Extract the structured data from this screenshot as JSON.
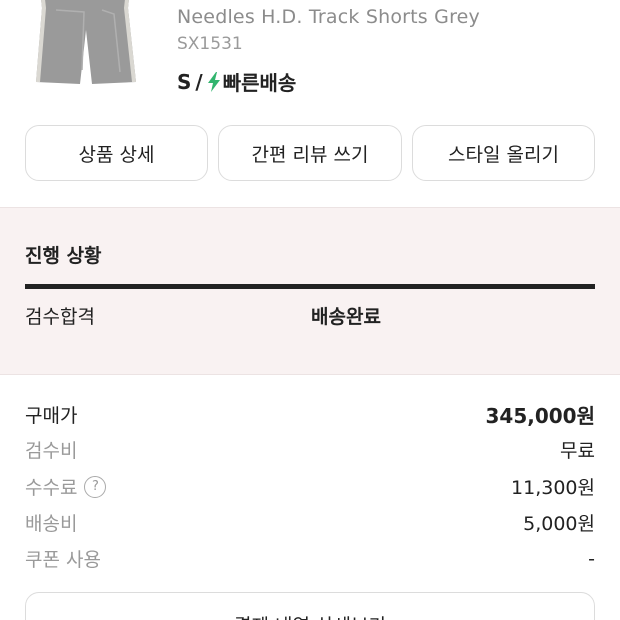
{
  "product": {
    "name": "Needles H.D. Track Shorts Grey",
    "model_code": "SX1531",
    "size": "S",
    "separator": "/",
    "shipping_label": "빠른배송",
    "shipping_icon": "lightning-bolt-icon",
    "accent_color": "#31b46e"
  },
  "actions": {
    "product_detail": "상품 상세",
    "quick_review": "간편 리뷰 쓰기",
    "post_style": "스타일 올리기"
  },
  "progress": {
    "title": "진행 상황",
    "steps": [
      "검수합격",
      "배송완료"
    ],
    "completed_fraction": 1.0
  },
  "price_summary": {
    "rows": [
      {
        "label": "구매가",
        "value": "345,000원"
      },
      {
        "label": "검수비",
        "value": "무료"
      },
      {
        "label": "수수료",
        "value": "11,300원",
        "help": "?"
      },
      {
        "label": "배송비",
        "value": "5,000원"
      },
      {
        "label": "쿠폰 사용",
        "value": "-"
      }
    ]
  },
  "payment_detail_button": "결제 내역 상세보기"
}
